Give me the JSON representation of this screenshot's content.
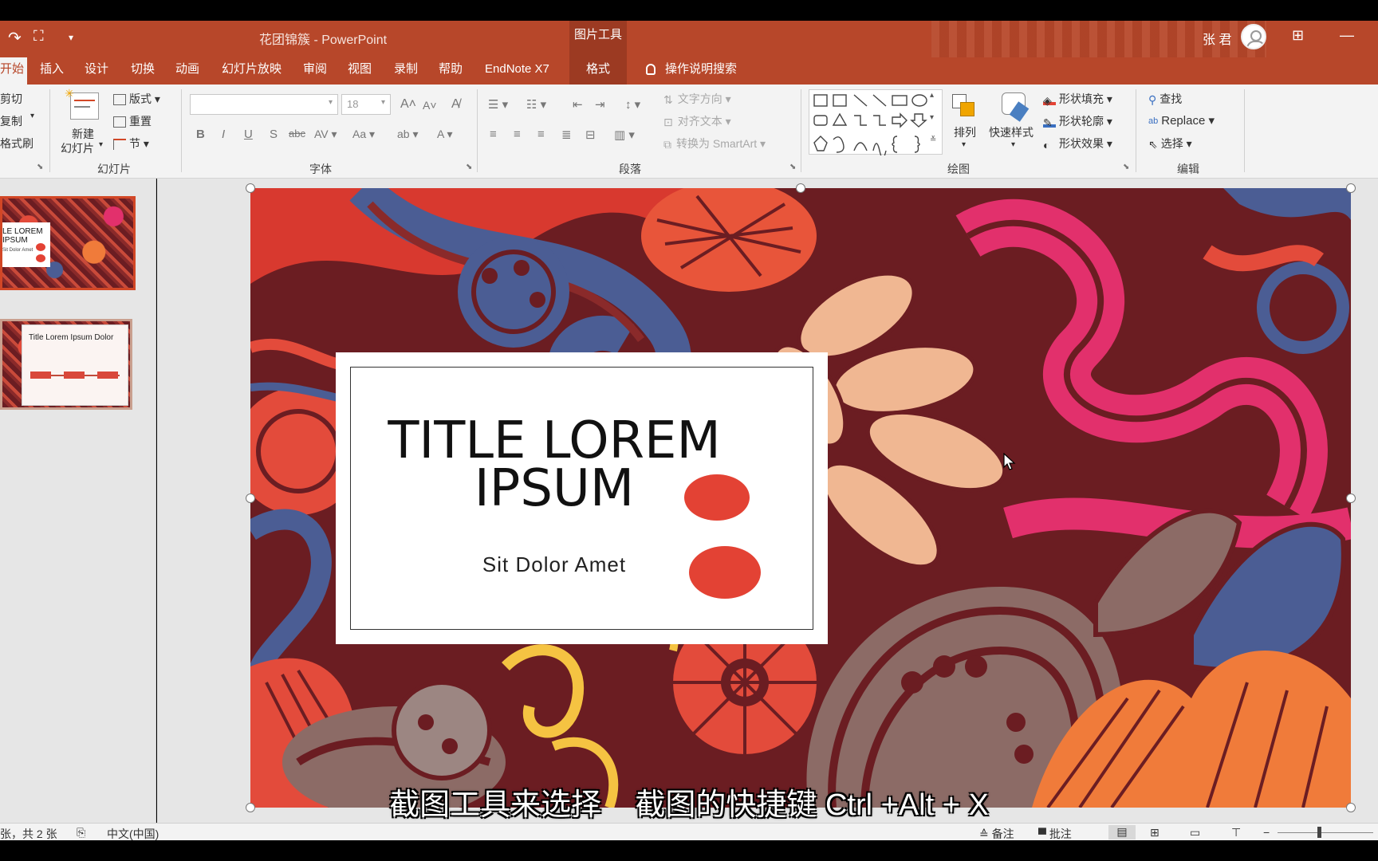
{
  "app": {
    "doc_title": "花团锦簇  -  PowerPoint",
    "context_tool_title": "图片工具",
    "user_name": "张 君",
    "accent": "#b7472a",
    "context_accent": "#9c3a22"
  },
  "tabs": [
    {
      "label": "开始",
      "active": true
    },
    {
      "label": "插入"
    },
    {
      "label": "设计"
    },
    {
      "label": "切换"
    },
    {
      "label": "动画"
    },
    {
      "label": "幻灯片放映"
    },
    {
      "label": "审阅"
    },
    {
      "label": "视图"
    },
    {
      "label": "录制"
    },
    {
      "label": "帮助"
    },
    {
      "label": "EndNote X7"
    },
    {
      "label": "格式",
      "context": true
    }
  ],
  "tell_me": "操作说明搜索",
  "ribbon": {
    "clipboard": {
      "cut": "剪切",
      "copy": "复制",
      "format_painter": "格式刷"
    },
    "slides": {
      "new_slide_line1": "新建",
      "new_slide_line2": "幻灯片",
      "layout": "版式",
      "reset": "重置",
      "section": "节",
      "group_label": "幻灯片"
    },
    "font": {
      "size": "18",
      "group_label": "字体"
    },
    "paragraph": {
      "text_direction": "文字方向",
      "align_text": "对齐文本",
      "smartart": "转换为 SmartArt",
      "group_label": "段落"
    },
    "drawing": {
      "arrange": "排列",
      "quick_styles": "快速样式",
      "shape_fill": "形状填充",
      "shape_outline": "形状轮廓",
      "shape_effects": "形状效果",
      "group_label": "绘图"
    },
    "editing": {
      "find": "查找",
      "replace": "Replace",
      "select": "选择",
      "group_label": "编辑"
    }
  },
  "thumbnails": [
    {
      "title": "LE LOREM IPSUM",
      "sub": "Sit Dolor Amet"
    },
    {
      "title": "Title Lorem Ipsum Dolor"
    }
  ],
  "slide": {
    "title": "TITLE LOREM IPSUM",
    "subtitle": "Sit Dolor Amet",
    "dot_color": "#e34234"
  },
  "caption": "截图工具来选择    截图的快捷键 Ctrl +Alt + X",
  "status": {
    "slide_info": "张，共 2 张",
    "language": "中文(中国)",
    "notes": "备注",
    "comments": "批注"
  }
}
